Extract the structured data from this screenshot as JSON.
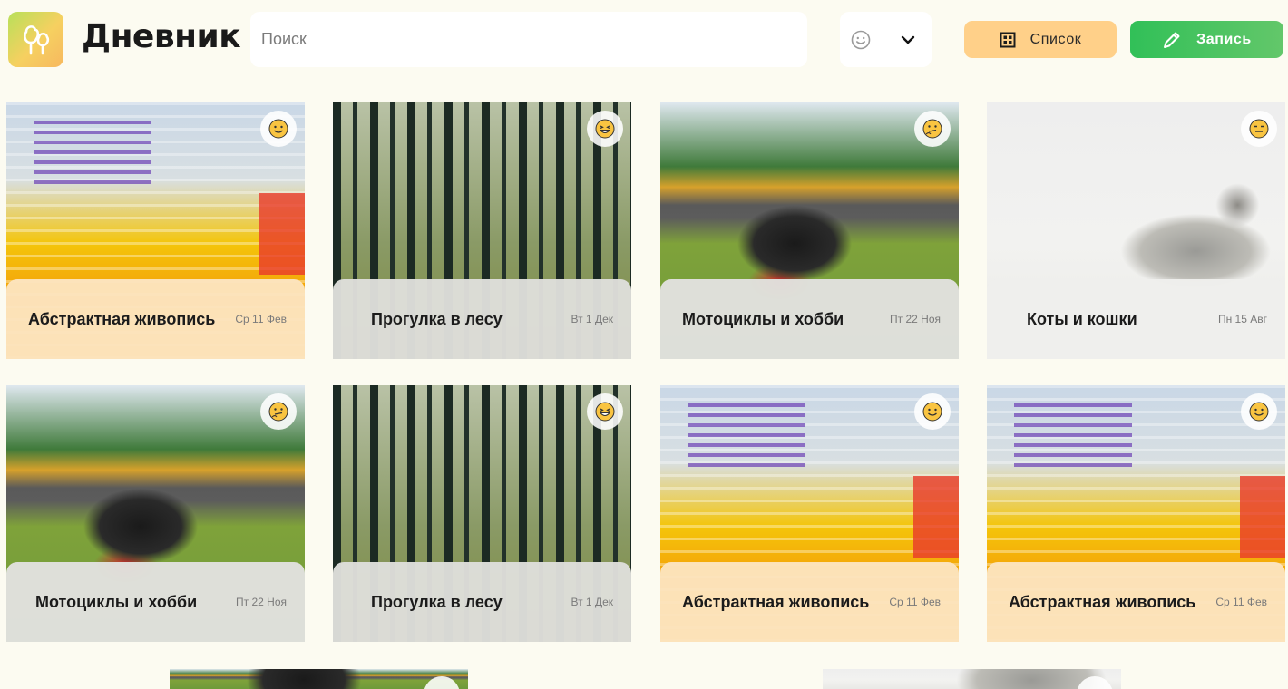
{
  "header": {
    "title": "Дневник",
    "search_placeholder": "Поиск",
    "list_button": "Список",
    "write_button": "Запись"
  },
  "cards": [
    {
      "title": "Абстрактная живопись",
      "date": "Ср 11 Фев",
      "image": "abstract-painting",
      "mood": "smiling-face"
    },
    {
      "title": "Прогулка в лесу",
      "date": "Вт 1 Дек",
      "image": "forest",
      "mood": "grinning-face"
    },
    {
      "title": "Мотоциклы и хобби",
      "date": "Пт 22 Ноя",
      "image": "motorcycle",
      "mood": "thinking-face"
    },
    {
      "title": "Коты и кошки",
      "date": "Пн 15 Авг",
      "image": "kitten",
      "mood": "expressionless-face"
    },
    {
      "title": "Мотоциклы и хобби",
      "date": "Пт 22 Ноя",
      "image": "motorcycle",
      "mood": "thinking-face"
    },
    {
      "title": "Прогулка в лесу",
      "date": "Вт 1 Дек",
      "image": "forest",
      "mood": "grinning-face"
    },
    {
      "title": "Абстрактная живопись",
      "date": "Ср 11 Фев",
      "image": "abstract-painting",
      "mood": "smiling-face"
    },
    {
      "title": "Абстрактная живопись",
      "date": "Ср 11 Фев",
      "image": "abstract-painting",
      "mood": "smiling-face"
    }
  ],
  "partial_cards": [
    {
      "image": "motorcycle"
    },
    {
      "image": "kitten"
    }
  ],
  "colors": {
    "background": "#fcfbf1",
    "list_button": "#ffd089",
    "write_button": "#31c058"
  }
}
